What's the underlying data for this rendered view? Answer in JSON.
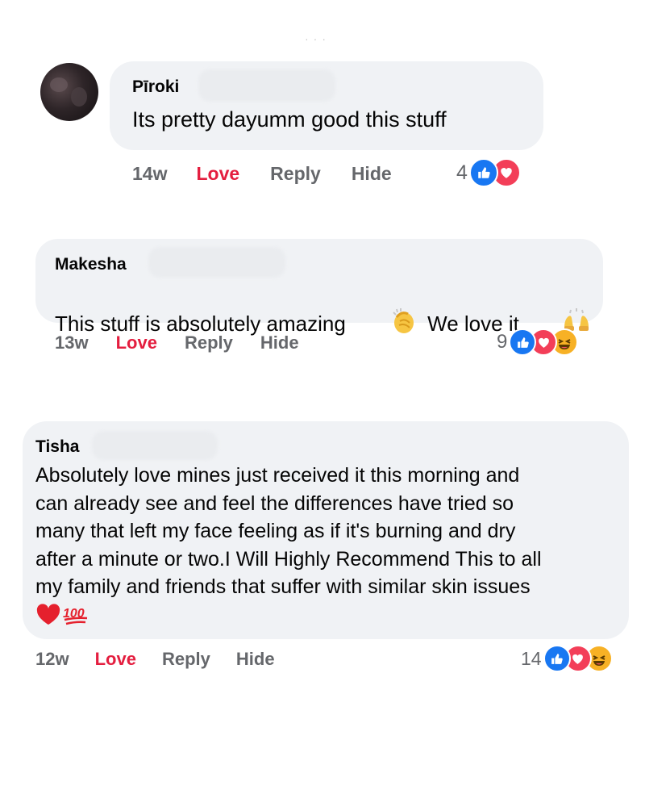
{
  "comments": [
    {
      "name": "Pīroki",
      "text": "Its pretty dayumm good this stuff",
      "time": "14w",
      "love": "Love",
      "reply": "Reply",
      "hide": "Hide",
      "reaction_count": "4",
      "reactions": [
        "like-icon",
        "love-icon"
      ]
    },
    {
      "name": "Makesha",
      "text_a": "This stuff is absolutely amazing",
      "text_b": "We love it",
      "emojis": [
        "clapping-hands-emoji",
        "raising-hands-emoji"
      ],
      "time": "13w",
      "love": "Love",
      "reply": "Reply",
      "hide": "Hide",
      "reaction_count": "9",
      "reactions": [
        "like-icon",
        "love-icon",
        "haha-icon"
      ]
    },
    {
      "name": "Tisha",
      "lines": [
        "Absolutely love mines just received it this morning and",
        "can already see and feel the differences have tried so",
        "many that left my face feeling as if it's burning and dry",
        "after a minute or two.I Will Highly Recommend This to all",
        "my family and friends that suffer with similar skin issues"
      ],
      "emojis": [
        "red-heart-emoji",
        "hundred-points-emoji"
      ],
      "time": "12w",
      "love": "Love",
      "reply": "Reply",
      "hide": "Hide",
      "reaction_count": "14",
      "reactions": [
        "like-icon",
        "love-icon",
        "haha-icon"
      ]
    }
  ],
  "colors": {
    "bubble": "#f0f2f5",
    "meta_text": "#65676b",
    "love_text": "#e41e3f",
    "like_blue": "#1877f2",
    "love_red": "#f33e58",
    "haha_yellow": "#f7b125"
  }
}
